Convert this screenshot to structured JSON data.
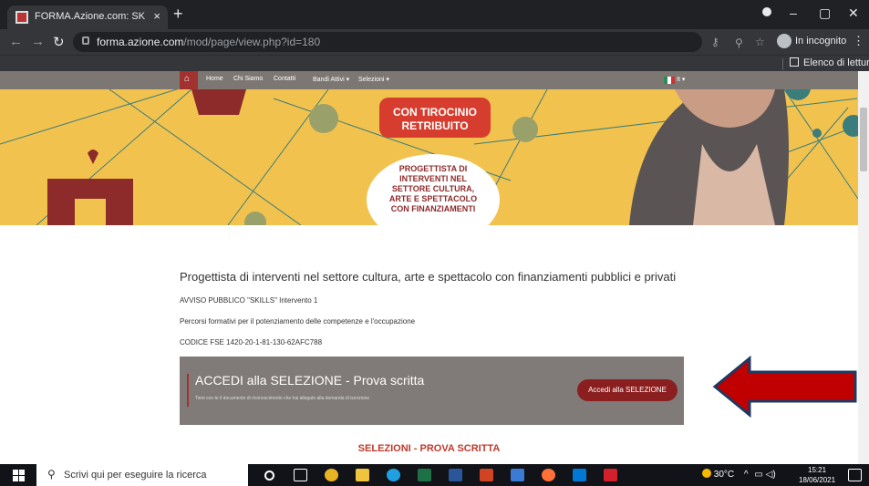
{
  "browser": {
    "tab_title": "FORMA.Azione.com: SKILLS CULT",
    "tab_close": "×",
    "new_tab": "+",
    "window_controls": [
      "–",
      "▢",
      "✕"
    ],
    "url_domain": "forma.azione.com",
    "url_path": "/mod/page/view.php?id=180",
    "incognito_label": "In incognito",
    "reading_list_label": "Elenco di lettura",
    "menu_dots": "⋮"
  },
  "site_nav": {
    "home_icon": "home-icon",
    "items": [
      "Home",
      "Chi Siamo",
      "Contatti",
      "Bandi Attivi ▾",
      "Selezioni ▾"
    ],
    "lang": "It ▾"
  },
  "hero": {
    "badge1": [
      "CON TIROCINIO",
      "RETRIBUITO"
    ],
    "badge2": [
      "PROGETTISTA DI",
      "INTERVENTI NEL",
      "SETTORE CULTURA,",
      "ARTE E SPETTACOLO",
      "CON FINANZIAMENTI"
    ]
  },
  "content": {
    "title": "Progettista di interventi nel settore cultura, arte e spettacolo con finanziamenti pubblici e privati",
    "line1": "AVVISO PUBBLICO \"SKILLS\" Intervento 1",
    "line2": "Percorsi formativi per il potenziamento delle competenze e l'occupazione",
    "line3": "CODICE FSE 1420-20-1-81-130-62AFC788"
  },
  "cta": {
    "heading": "ACCEDI alla SELEZIONE - Prova scritta",
    "subtext": "Tieni con te il documento di riconoscimento che hai allegato alla domanda di iscrizione",
    "button": "Accedi alla SELEZIONE"
  },
  "section_heading": "SELEZIONI - PROVA SCRITTA",
  "taskbar": {
    "search_placeholder": "Scrivi qui per eseguire la ricerca",
    "temperature": "30°C",
    "time": "15:21",
    "date": "18/06/2021"
  },
  "colors": {
    "accent_red": "#a2322f",
    "arrow_red": "#c00000",
    "arrow_blue": "#1f3864",
    "hero_yellow": "#f2c24f"
  }
}
